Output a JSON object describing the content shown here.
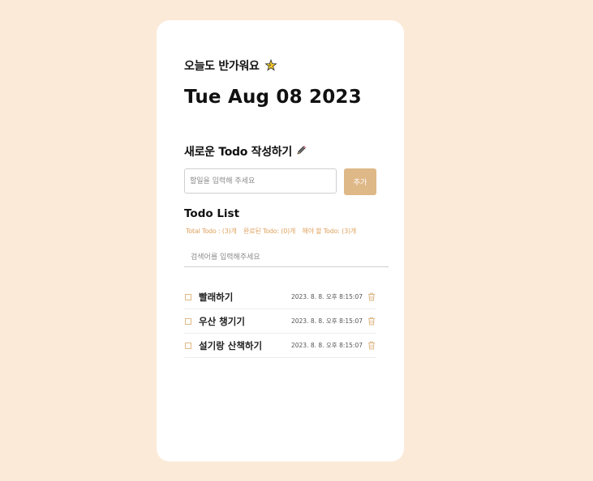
{
  "header": {
    "greeting": "오늘도 반가워요",
    "date": "Tue Aug 08 2023"
  },
  "new_todo": {
    "title": "새로운 Todo 작성하기",
    "placeholder": "할일을 입력해 주세요",
    "add_label": "추가"
  },
  "todo_list": {
    "title": "Todo List",
    "stats": {
      "total": "Total Todo : (3)개",
      "done": "완료된 Todo: (0)개",
      "remaining": "해야 할 Todo: (3)개"
    },
    "search_placeholder": "검색어를 입력해주세요",
    "items": [
      {
        "text": "빨래하기",
        "date": "2023. 8. 8. 오후 8:15:07",
        "done": false
      },
      {
        "text": "우산 챙기기",
        "date": "2023. 8. 8. 오후 8:15:07",
        "done": false
      },
      {
        "text": "설기랑 산책하기",
        "date": "2023. 8. 8. 오후 8:15:07",
        "done": false
      }
    ]
  },
  "icons": {
    "greeting": "sparkle-bird-icon",
    "new_todo": "pencil-icon",
    "delete": "trash-icon"
  },
  "colors": {
    "background": "#fbead8",
    "accent": "#deb887",
    "stats_text": "#e0a25e"
  }
}
